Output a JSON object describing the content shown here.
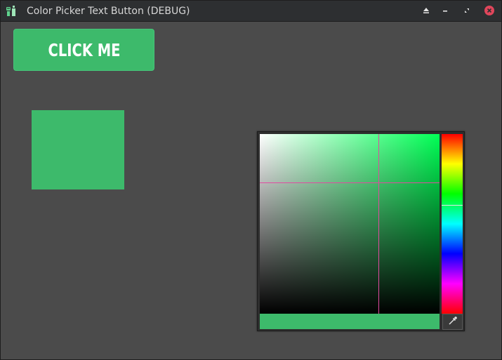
{
  "window": {
    "title": "Color Picker Text Button (DEBUG)",
    "icon": "godot-robot-icon"
  },
  "titlebar_buttons": [
    {
      "name": "eject-icon"
    },
    {
      "name": "minimize-icon"
    },
    {
      "name": "restore-icon"
    },
    {
      "name": "close-icon"
    }
  ],
  "button": {
    "label": "CLICK ME"
  },
  "colors": {
    "selected": "#3dba6b",
    "hue": "#00ff55",
    "crosshair": "#e04aa0"
  },
  "picker": {
    "saturation": 0.66,
    "value": 0.73,
    "hue_degrees": 142
  }
}
